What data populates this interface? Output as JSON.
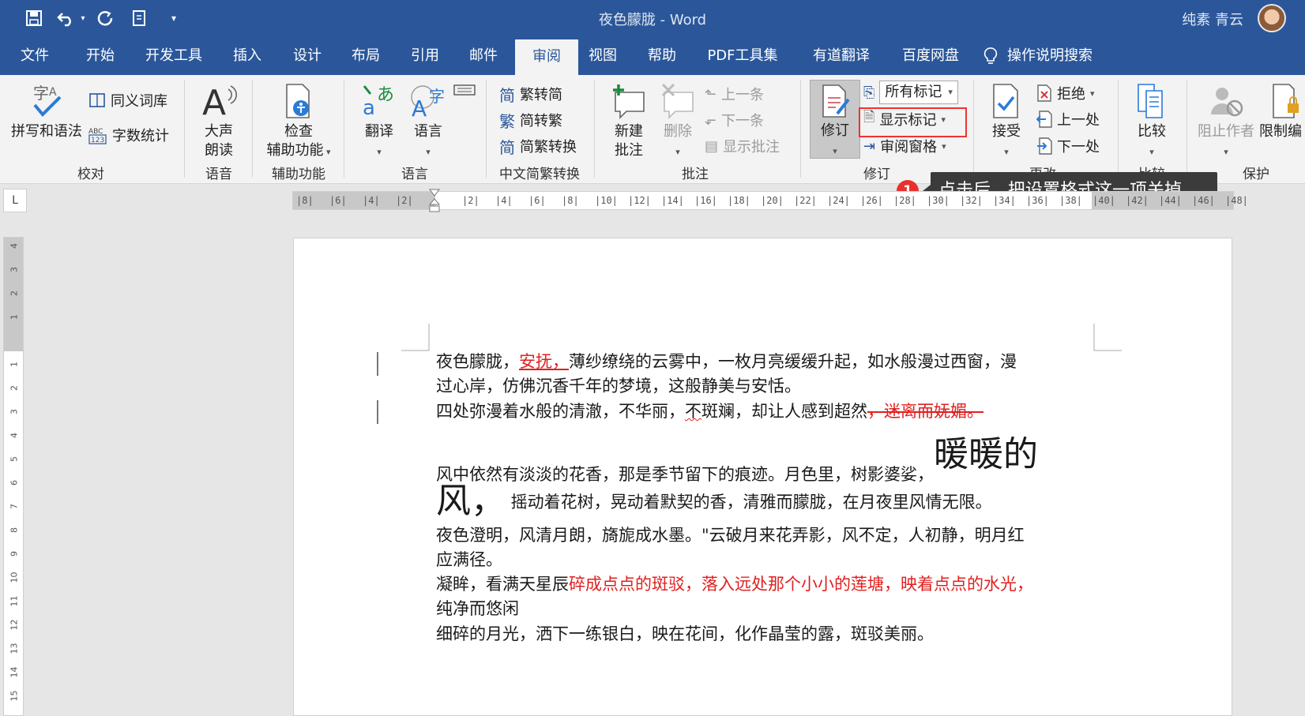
{
  "title_bar": {
    "document_title": "夜色朦胧  -  Word",
    "user_name": "纯素 青云"
  },
  "tabs": [
    "文件",
    "开始",
    "开发工具",
    "插入",
    "设计",
    "布局",
    "引用",
    "邮件",
    "审阅",
    "视图",
    "帮助",
    "PDF工具集",
    "有道翻译",
    "百度网盘",
    "操作说明搜索"
  ],
  "ribbon": {
    "proofing": {
      "spelling": "拼写和语法",
      "thesaurus": "同义词库",
      "word_count": "字数统计",
      "label": "校对"
    },
    "speech": {
      "read_aloud_1": "大声",
      "read_aloud_2": "朗读",
      "label": "语音"
    },
    "accessibility": {
      "check_1": "检查",
      "check_2": "辅助功能",
      "label": "辅助功能"
    },
    "language": {
      "translate": "翻译",
      "language": "语言",
      "label": "语言"
    },
    "chinese": {
      "to_simplified": "繁转简",
      "to_traditional": "简转繁",
      "convert": "简繁转换",
      "label": "中文简繁转换"
    },
    "comments": {
      "new_1": "新建",
      "new_2": "批注",
      "delete": "删除",
      "previous": "上一条",
      "next": "下一条",
      "show": "显示批注",
      "label": "批注"
    },
    "tracking": {
      "track_changes": "修订",
      "all_markup": "所有标记",
      "show_markup": "显示标记",
      "reviewing_pane": "审阅窗格",
      "label": "修订"
    },
    "changes": {
      "accept": "接受",
      "reject": "拒绝",
      "previous": "上一处",
      "next": "下一处",
      "label": "更改"
    },
    "compare": {
      "compare": "比较",
      "label": "比较"
    },
    "protect": {
      "block_authors": "阻止作者",
      "restrict": "限制编",
      "label": "保护"
    }
  },
  "tooltip": {
    "badge": "1",
    "text": "点击后、把设置格式这一项关掉"
  },
  "ruler": {
    "corner": "L",
    "h_ticks": [
      "8",
      "6",
      "4",
      "2",
      "",
      "2",
      "4",
      "6",
      "8",
      "10",
      "12",
      "14",
      "16",
      "18",
      "20",
      "22",
      "24",
      "26",
      "28",
      "30",
      "32",
      "34",
      "36",
      "38",
      "40",
      "42",
      "44",
      "46",
      "48"
    ],
    "v_ticks": [
      "4",
      "3",
      "2",
      "1",
      "",
      "1",
      "2",
      "3",
      "4",
      "5",
      "6",
      "7",
      "8",
      "9",
      "10",
      "11",
      "12",
      "13",
      "14",
      "15"
    ]
  },
  "document": {
    "l1_a": "夜色朦胧，",
    "l1_ins": "安抚，",
    "l1_b": "薄纱缭绕的云雾中，一枚月亮缓缓升起，如水般漫过西窗，漫",
    "l2": "过心岸，仿佛沉香千年的梦境，这般静美与安恬。",
    "l3_a": "四处弥漫着水般的清澈，不华丽，",
    "l3_sq": "不",
    "l3_b": "斑斓，却让人感到超然",
    "l3_del": "，迷离而妩媚。",
    "l4_a": "风中依然有淡淡的花香，那是季节留下的痕迹。月色里，树影婆娑，",
    "l4_big": "暖暖的",
    "l5_big": "风，",
    "l5_b": " 摇动着花树，晃动着默契的香，清雅而朦胧，在月夜里风情无限。",
    "l6": "夜色澄明，风清月朗，旖旎成水墨。\"云破月来花弄影，风不定，人初静，明月红",
    "l7": "应满径。",
    "l8_a": "凝眸，看满天星辰",
    "l8_red": "碎成点点的斑驳，落入远处那个小小的莲塘，映着点点的水光，",
    "l9": "纯净而悠闲",
    "l10": "细碎的月光，洒下一练银白，映在花间，化作晶莹的露，斑驳美丽。"
  }
}
